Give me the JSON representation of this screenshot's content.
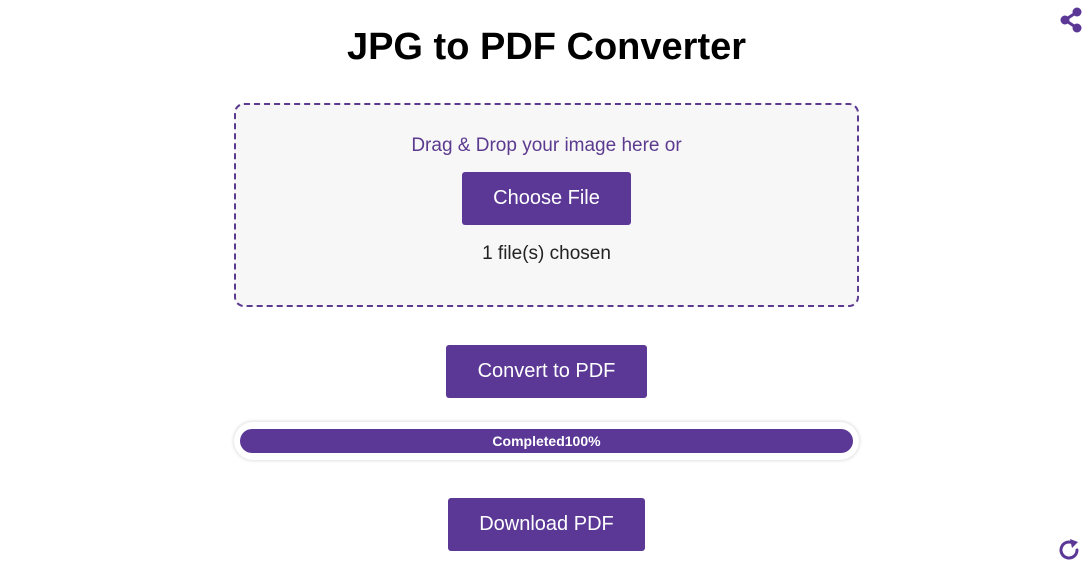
{
  "header": {
    "title": "JPG to PDF Converter",
    "share_icon": "share-icon",
    "refresh_icon": "refresh-icon"
  },
  "dropzone": {
    "prompt": "Drag & Drop your image here or",
    "choose_label": "Choose File",
    "file_status": "1 file(s) chosen"
  },
  "actions": {
    "convert_label": "Convert to PDF",
    "download_label": "Download PDF"
  },
  "progress": {
    "label": "Completed100%",
    "fraction": 1.0
  },
  "colors": {
    "accent": "#5b3896",
    "dropzone_border": "#5b3a8f",
    "dropzone_bg": "#f8f7f8"
  }
}
